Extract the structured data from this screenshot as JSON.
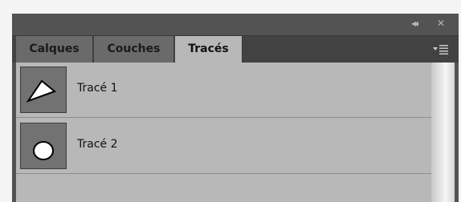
{
  "title_controls": {
    "collapse_glyph": "◂◂",
    "close_glyph": "✕"
  },
  "tabs": [
    {
      "label": "Calques",
      "active": false
    },
    {
      "label": "Couches",
      "active": false
    },
    {
      "label": "Tracés",
      "active": true
    }
  ],
  "paths": [
    {
      "label": "Tracé 1",
      "thumb_shape": "triangle"
    },
    {
      "label": "Tracé 2",
      "thumb_shape": "ellipse"
    }
  ],
  "colors": {
    "panel_bg": "#535353",
    "active_tab": "#b8b8b8",
    "inactive_tab": "#6a6a6a",
    "thumb_bg": "#727272"
  }
}
